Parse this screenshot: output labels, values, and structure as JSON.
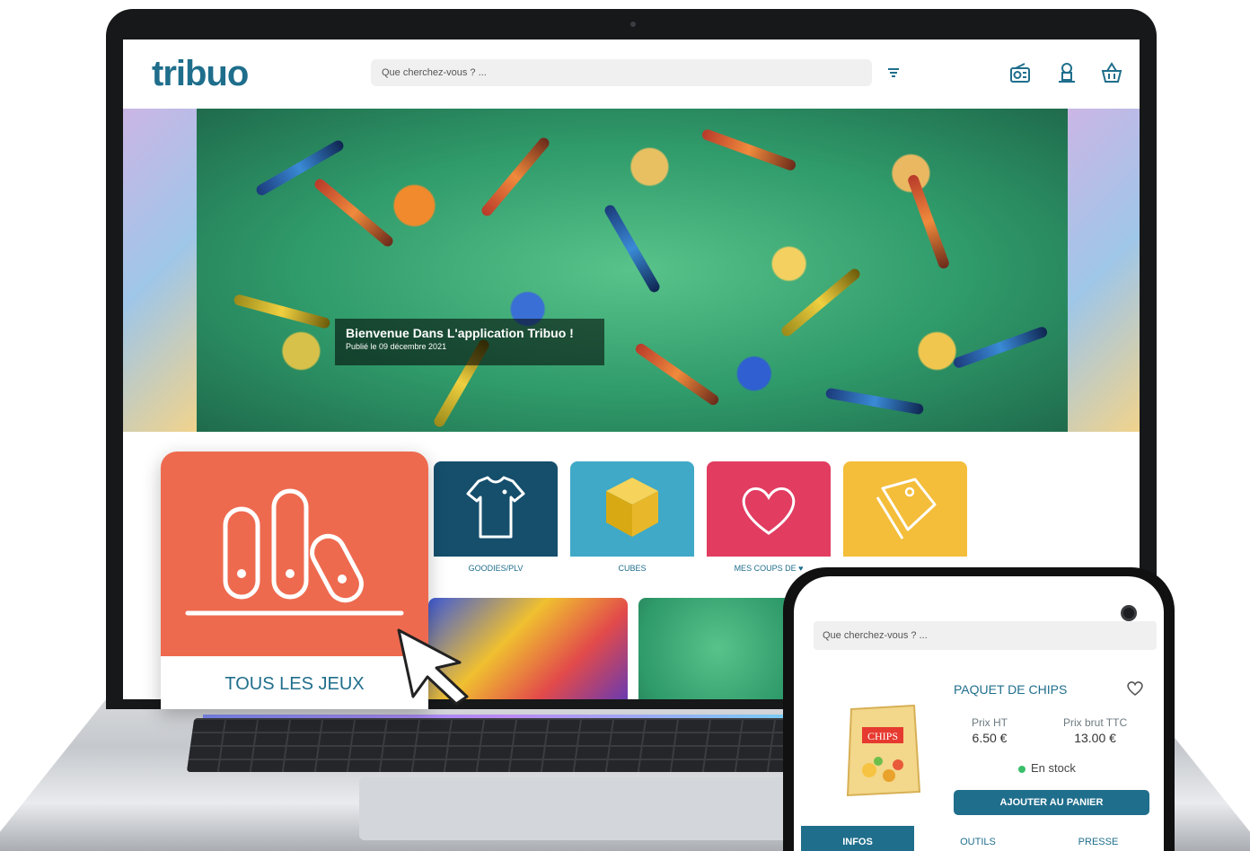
{
  "header": {
    "logo": "tribuo",
    "search_placeholder": "Que cherchez-vous ? ...",
    "icons": [
      "filter-icon",
      "radio-icon",
      "user-icon",
      "basket-icon"
    ]
  },
  "hero": {
    "title": "Bienvenue Dans L'application Tribuo !",
    "date": "Publié le 09 décembre 2021"
  },
  "categories": [
    {
      "label": "GOODIES/PLV",
      "color": "#154f6c",
      "icon": "tshirt-icon"
    },
    {
      "label": "CUBES",
      "color": "#3fa9c7",
      "icon": "cube-icon"
    },
    {
      "label": "MES COUPS DE",
      "color": "#e23c61",
      "icon": "heart-icon"
    },
    {
      "label": "",
      "color": "#f4bd3a",
      "icon": "tag-icon"
    }
  ],
  "featured": {
    "label": "TOUS LES JEUX",
    "color": "#ee6a4f",
    "icon": "shelf-icon"
  },
  "phone": {
    "search_placeholder": "Que cherchez-vous ? ...",
    "product": {
      "title": "PAQUET DE CHIPS",
      "image_text": "CHIPS",
      "price_ht_label": "Prix HT",
      "price_ht": "6.50 €",
      "price_ttc_label": "Prix brut TTC",
      "price_ttc": "13.00 €",
      "stock": "En stock",
      "cart_button": "AJOUTER AU PANIER"
    },
    "tabs": [
      "INFOS",
      "OUTILS",
      "PRESSE"
    ]
  },
  "colors": {
    "brand": "#1f6e8c",
    "accent": "#ee6a4f",
    "stock_ok": "#3bbf6a"
  }
}
